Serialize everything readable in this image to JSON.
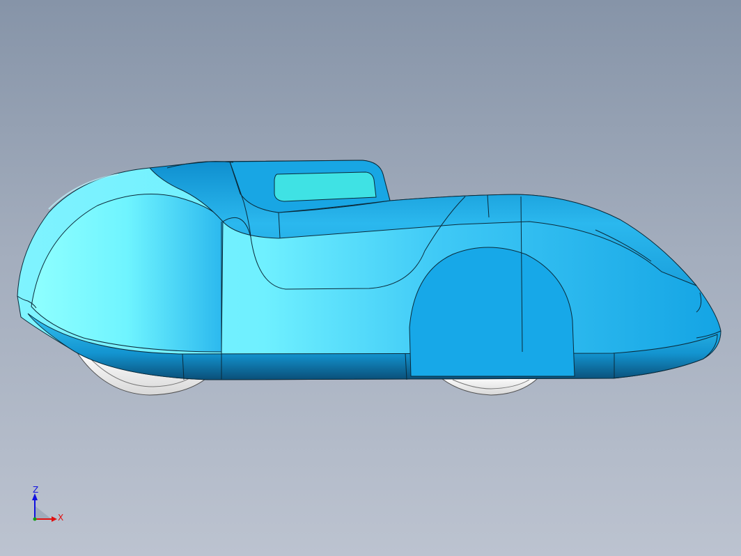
{
  "viewport": {
    "background_top": "#8694a8",
    "background_bottom": "#bcc3d0"
  },
  "model": {
    "body_color": "#1aa8e6",
    "body_highlight": "#88ffff",
    "window_color": "#40e0e0",
    "edge_color": "#0a2a3a",
    "wheel_color": "#f2f2f2"
  },
  "triad": {
    "z_label": "Z",
    "x_label": "X",
    "z_color": "#1010e0",
    "x_color": "#e01010",
    "y_color": "#10a010"
  }
}
